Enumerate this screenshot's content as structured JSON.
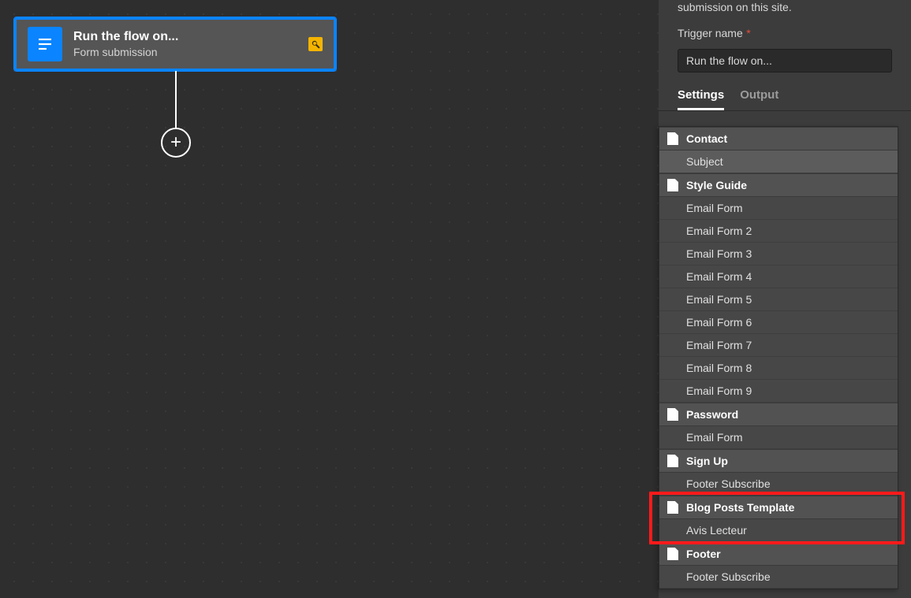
{
  "node": {
    "title": "Run the flow on...",
    "subtitle": "Form submission"
  },
  "sidebar": {
    "description_tail": "submission on this site.",
    "trigger_name_label": "Trigger name",
    "trigger_name_value": "Run the flow on...",
    "tabs": {
      "settings": "Settings",
      "output": "Output"
    }
  },
  "dropdown": [
    {
      "type": "header",
      "label": "Contact"
    },
    {
      "type": "item",
      "label": "Subject",
      "selected": true
    },
    {
      "type": "header",
      "label": "Style Guide"
    },
    {
      "type": "item",
      "label": "Email Form"
    },
    {
      "type": "item",
      "label": "Email Form 2"
    },
    {
      "type": "item",
      "label": "Email Form 3"
    },
    {
      "type": "item",
      "label": "Email Form 4"
    },
    {
      "type": "item",
      "label": "Email Form 5"
    },
    {
      "type": "item",
      "label": "Email Form 6"
    },
    {
      "type": "item",
      "label": "Email Form 7"
    },
    {
      "type": "item",
      "label": "Email Form 8"
    },
    {
      "type": "item",
      "label": "Email Form 9"
    },
    {
      "type": "header",
      "label": "Password"
    },
    {
      "type": "item",
      "label": "Email Form"
    },
    {
      "type": "header",
      "label": "Sign Up"
    },
    {
      "type": "item",
      "label": "Footer Subscribe"
    },
    {
      "type": "header",
      "label": "Blog Posts Template",
      "hl": true
    },
    {
      "type": "item",
      "label": "Avis Lecteur",
      "hl": true
    },
    {
      "type": "header",
      "label": "Footer"
    },
    {
      "type": "item",
      "label": "Footer Subscribe"
    }
  ]
}
